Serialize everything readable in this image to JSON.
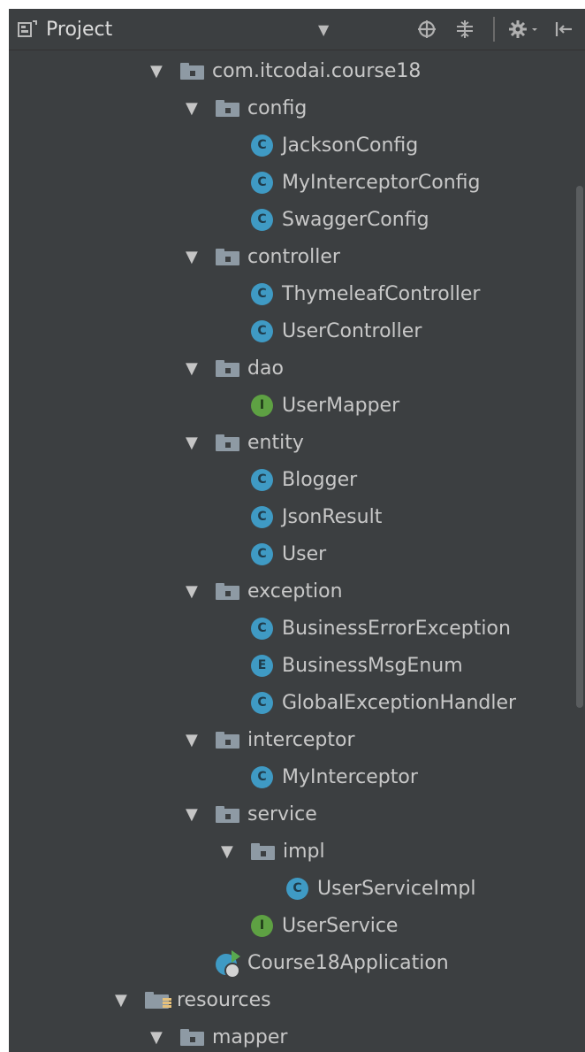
{
  "header": {
    "title": "Project",
    "dropdown_glyph": "▼",
    "icons": [
      "project-view-icon",
      "locate-icon",
      "collapse-all-icon",
      "settings-gear-icon",
      "hide-panel-icon"
    ]
  },
  "tree": {
    "items": [
      {
        "label": "com.itcodai.course18",
        "kind": "package",
        "level": 0,
        "expanded": true
      },
      {
        "label": "config",
        "kind": "package",
        "level": 1,
        "expanded": true
      },
      {
        "label": "JacksonConfig",
        "kind": "class",
        "badge": "C",
        "level": 2
      },
      {
        "label": "MyInterceptorConfig",
        "kind": "class",
        "badge": "C",
        "level": 2
      },
      {
        "label": "SwaggerConfig",
        "kind": "class",
        "badge": "C",
        "level": 2
      },
      {
        "label": "controller",
        "kind": "package",
        "level": 1,
        "expanded": true
      },
      {
        "label": "ThymeleafController",
        "kind": "class",
        "badge": "C",
        "level": 2
      },
      {
        "label": "UserController",
        "kind": "class",
        "badge": "C",
        "level": 2
      },
      {
        "label": "dao",
        "kind": "package",
        "level": 1,
        "expanded": true
      },
      {
        "label": "UserMapper",
        "kind": "interface",
        "badge": "I",
        "level": 2
      },
      {
        "label": "entity",
        "kind": "package",
        "level": 1,
        "expanded": true
      },
      {
        "label": "Blogger",
        "kind": "class",
        "badge": "C",
        "level": 2
      },
      {
        "label": "JsonResult",
        "kind": "class",
        "badge": "C",
        "level": 2
      },
      {
        "label": "User",
        "kind": "class",
        "badge": "C",
        "level": 2
      },
      {
        "label": "exception",
        "kind": "package",
        "level": 1,
        "expanded": true
      },
      {
        "label": "BusinessErrorException",
        "kind": "class",
        "badge": "C",
        "level": 2
      },
      {
        "label": "BusinessMsgEnum",
        "kind": "enum",
        "badge": "E",
        "level": 2
      },
      {
        "label": "GlobalExceptionHandler",
        "kind": "class",
        "badge": "C",
        "level": 2
      },
      {
        "label": "interceptor",
        "kind": "package",
        "level": 1,
        "expanded": true
      },
      {
        "label": "MyInterceptor",
        "kind": "class",
        "badge": "C",
        "level": 2
      },
      {
        "label": "service",
        "kind": "package",
        "level": 1,
        "expanded": true
      },
      {
        "label": "impl",
        "kind": "package",
        "level": 2,
        "expanded": true
      },
      {
        "label": "UserServiceImpl",
        "kind": "class",
        "badge": "C",
        "level": 3
      },
      {
        "label": "UserService",
        "kind": "interface",
        "badge": "I",
        "level": 2
      },
      {
        "label": "Course18Application",
        "kind": "application",
        "level": 1
      },
      {
        "label": "resources",
        "kind": "resources",
        "level": -1,
        "expanded": true
      },
      {
        "label": "mapper",
        "kind": "package",
        "level": 0,
        "expanded": true
      }
    ]
  },
  "colors": {
    "background": "#3c3f41",
    "text": "#c8c8c8",
    "class_badge": "#3f9ac4",
    "interface_badge": "#5ea143",
    "folder": "#8e9aa4"
  }
}
